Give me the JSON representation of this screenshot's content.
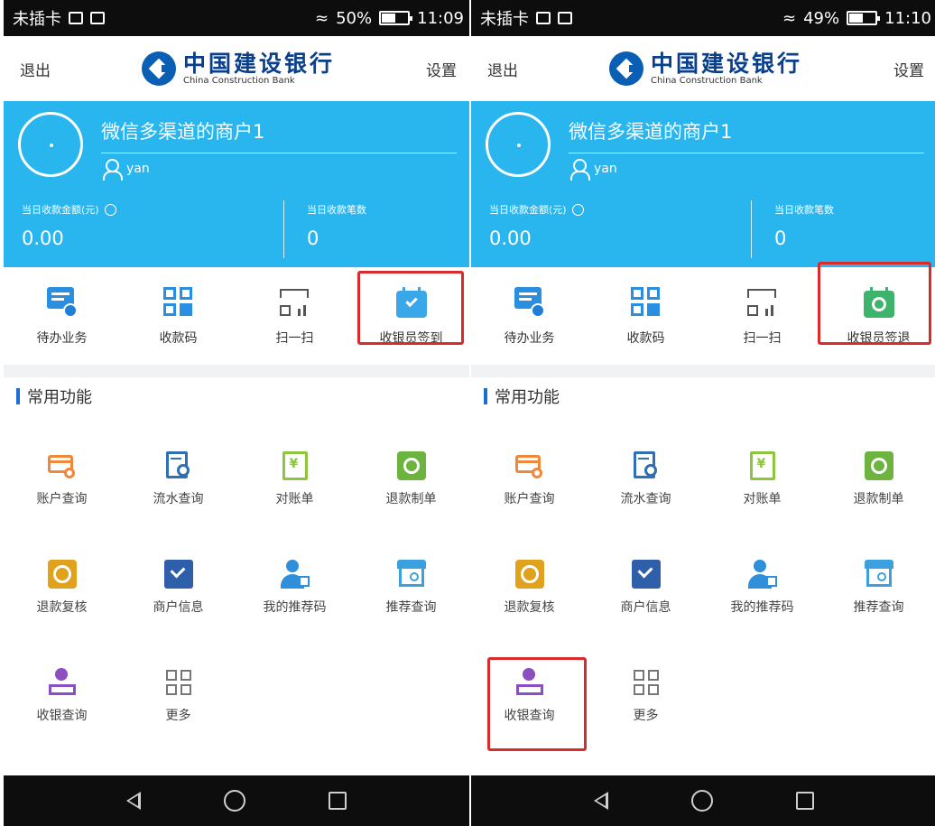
{
  "colors": {
    "accent_blue": "#29b6ef",
    "brand_blue": "#0a5fb4",
    "highlight_red": "#d92b2b",
    "section_bar": "#1a6fd0"
  },
  "screens": [
    {
      "status_bar": {
        "carrier": "未插卡",
        "battery": "50%",
        "time": "11:09"
      },
      "header": {
        "exit": "退出",
        "brand_cn": "中国建设银行",
        "brand_en": "China Construction Bank",
        "settings": "设置"
      },
      "merchant_name": "微信多渠道的商户1",
      "username": "yan",
      "stats": {
        "amount_label": "当日收款金额(元)",
        "amount_value": "0.00",
        "count_label": "当日收款笔数",
        "count_value": "0"
      },
      "top_menu": [
        {
          "label": "待办业务",
          "icon": "todo-icon"
        },
        {
          "label": "收款码",
          "icon": "qr-code-icon"
        },
        {
          "label": "扫一扫",
          "icon": "scan-icon"
        },
        {
          "label": "收银员签到",
          "icon": "calendar-check-icon",
          "highlighted": true
        }
      ],
      "section_title": "常用功能",
      "functions": [
        {
          "label": "账户查询",
          "icon": "account-search-icon"
        },
        {
          "label": "流水查询",
          "icon": "transaction-search-icon"
        },
        {
          "label": "对账单",
          "icon": "statement-icon"
        },
        {
          "label": "退款制单",
          "icon": "refund-create-icon"
        },
        {
          "label": "退款复核",
          "icon": "refund-review-icon"
        },
        {
          "label": "商户信息",
          "icon": "merchant-info-icon"
        },
        {
          "label": "我的推荐码",
          "icon": "referral-code-icon"
        },
        {
          "label": "推荐查询",
          "icon": "referral-search-icon"
        },
        {
          "label": "收银查询",
          "icon": "cashier-search-icon"
        },
        {
          "label": "更多",
          "icon": "more-grid-icon"
        }
      ]
    },
    {
      "status_bar": {
        "carrier": "未插卡",
        "battery": "49%",
        "time": "11:10"
      },
      "header": {
        "exit": "退出",
        "brand_cn": "中国建设银行",
        "brand_en": "China Construction Bank",
        "settings": "设置"
      },
      "merchant_name": "微信多渠道的商户1",
      "username": "yan",
      "stats": {
        "amount_label": "当日收款金额(元)",
        "amount_value": "0.00",
        "count_label": "当日收款笔数",
        "count_value": "0"
      },
      "top_menu": [
        {
          "label": "待办业务",
          "icon": "todo-icon"
        },
        {
          "label": "收款码",
          "icon": "qr-code-icon"
        },
        {
          "label": "扫一扫",
          "icon": "scan-icon"
        },
        {
          "label": "收银员签退",
          "icon": "calendar-signout-icon",
          "highlighted": true
        }
      ],
      "section_title": "常用功能",
      "functions": [
        {
          "label": "账户查询",
          "icon": "account-search-icon"
        },
        {
          "label": "流水查询",
          "icon": "transaction-search-icon"
        },
        {
          "label": "对账单",
          "icon": "statement-icon"
        },
        {
          "label": "退款制单",
          "icon": "refund-create-icon"
        },
        {
          "label": "退款复核",
          "icon": "refund-review-icon"
        },
        {
          "label": "商户信息",
          "icon": "merchant-info-icon"
        },
        {
          "label": "我的推荐码",
          "icon": "referral-code-icon"
        },
        {
          "label": "推荐查询",
          "icon": "referral-search-icon"
        },
        {
          "label": "收银查询",
          "icon": "cashier-search-icon",
          "highlighted": true
        },
        {
          "label": "更多",
          "icon": "more-grid-icon"
        }
      ]
    }
  ]
}
